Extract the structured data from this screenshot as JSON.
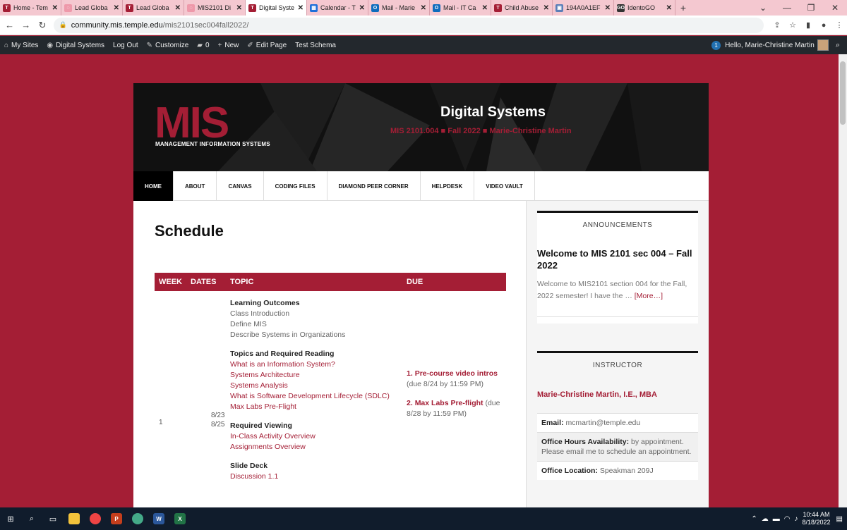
{
  "tabs": [
    {
      "title": "Home - Tem",
      "color": "#a41e35",
      "letter": "T",
      "active": false
    },
    {
      "title": "Lead Globa",
      "color": "#e9a",
      "letter": "◌",
      "active": false
    },
    {
      "title": "Lead Globa",
      "color": "#a41e35",
      "letter": "T",
      "active": false
    },
    {
      "title": "MIS2101 Di",
      "color": "#e9a",
      "letter": "◌",
      "active": false
    },
    {
      "title": "Digital Syste",
      "color": "#a41e35",
      "letter": "T",
      "active": true
    },
    {
      "title": "Calendar - T",
      "color": "#1e6fd9",
      "letter": "▦",
      "active": false
    },
    {
      "title": "Mail - Marie",
      "color": "#0f6cbd",
      "letter": "O",
      "active": false
    },
    {
      "title": "Mail - IT Ca",
      "color": "#0f6cbd",
      "letter": "O",
      "active": false
    },
    {
      "title": "Child Abuse",
      "color": "#a41e35",
      "letter": "T",
      "active": false
    },
    {
      "title": "194A0A1EF",
      "color": "#5b7fb8",
      "letter": "▣",
      "active": false
    },
    {
      "title": "IdentoGO",
      "color": "#333",
      "letter": "GO",
      "active": false
    }
  ],
  "browser": {
    "url_host": "community.mis.temple.edu",
    "url_path": "/mis2101sec004fall2022/"
  },
  "wpbar": {
    "my_sites": "My Sites",
    "site_name": "Digital Systems",
    "log_out": "Log Out",
    "customize": "Customize",
    "comments": "0",
    "new": "New",
    "edit_page": "Edit Page",
    "test_schema": "Test Schema",
    "notif_count": "1",
    "greeting": "Hello, Marie-Christine Martin"
  },
  "header": {
    "logo": "MIS",
    "logo_sub": "MANAGEMENT INFORMATION SYSTEMS",
    "title": "Digital Systems",
    "tagline": "MIS 2101.004 ■ Fall 2022 ■ Marie-Christine Martin"
  },
  "menu": [
    "HOME",
    "ABOUT",
    "CANVAS",
    "CODING FILES",
    "DIAMOND PEER CORNER",
    "HELPDESK",
    "VIDEO VAULT"
  ],
  "page": {
    "title": "Schedule",
    "columns": [
      "WEEK",
      "DATES",
      "TOPIC",
      "DUE"
    ],
    "row": {
      "week": "1",
      "dates": [
        "8/23",
        "8/25"
      ],
      "topic_groups": [
        {
          "head": "Learning Outcomes",
          "items": [
            "Class Introduction",
            "Define MIS",
            "Describe Systems in Organizations"
          ],
          "links": false
        },
        {
          "head": "Topics and Required Reading",
          "items": [
            "What is an Information System?",
            "Systems Architecture",
            "Systems Analysis",
            "What is Software Development Lifecycle (SDLC)",
            "Max Labs Pre-Flight"
          ],
          "links": true
        },
        {
          "head": "Required Viewing",
          "items": [
            "In-Class Activity Overview",
            "Assignments Overview"
          ],
          "links": true
        },
        {
          "head": "Slide Deck",
          "items": [
            "Discussion 1.1"
          ],
          "links": true
        }
      ],
      "due": [
        {
          "num": "1.",
          "link": "Pre-course video intros",
          "note": "(due 8/24 by 11:59 PM)"
        },
        {
          "num": "2.",
          "link": "Max Labs Pre-flight",
          "note": "(due 8/28 by 11:59 PM)"
        }
      ]
    }
  },
  "sidebar": {
    "announcements": {
      "title": "ANNOUNCEMENTS",
      "post_title": "Welcome to MIS 2101 sec 004 – Fall 2022",
      "excerpt": "Welcome to MIS2101 section 004 for the Fall, 2022 semester! I have the …",
      "more": "[More…]"
    },
    "instructor": {
      "title": "INSTRUCTOR",
      "name": "Marie-Christine Martin, I.E., MBA",
      "email_label": "Email:",
      "email": "mcmartin@temple.edu",
      "hours_label": "Office Hours Availability:",
      "hours": "by appointment. Please email me to schedule an appointment.",
      "location_label": "Office Location:",
      "location": "Speakman 209J"
    }
  },
  "taskbar": {
    "time": "10:44 AM",
    "date": "8/18/2022"
  }
}
